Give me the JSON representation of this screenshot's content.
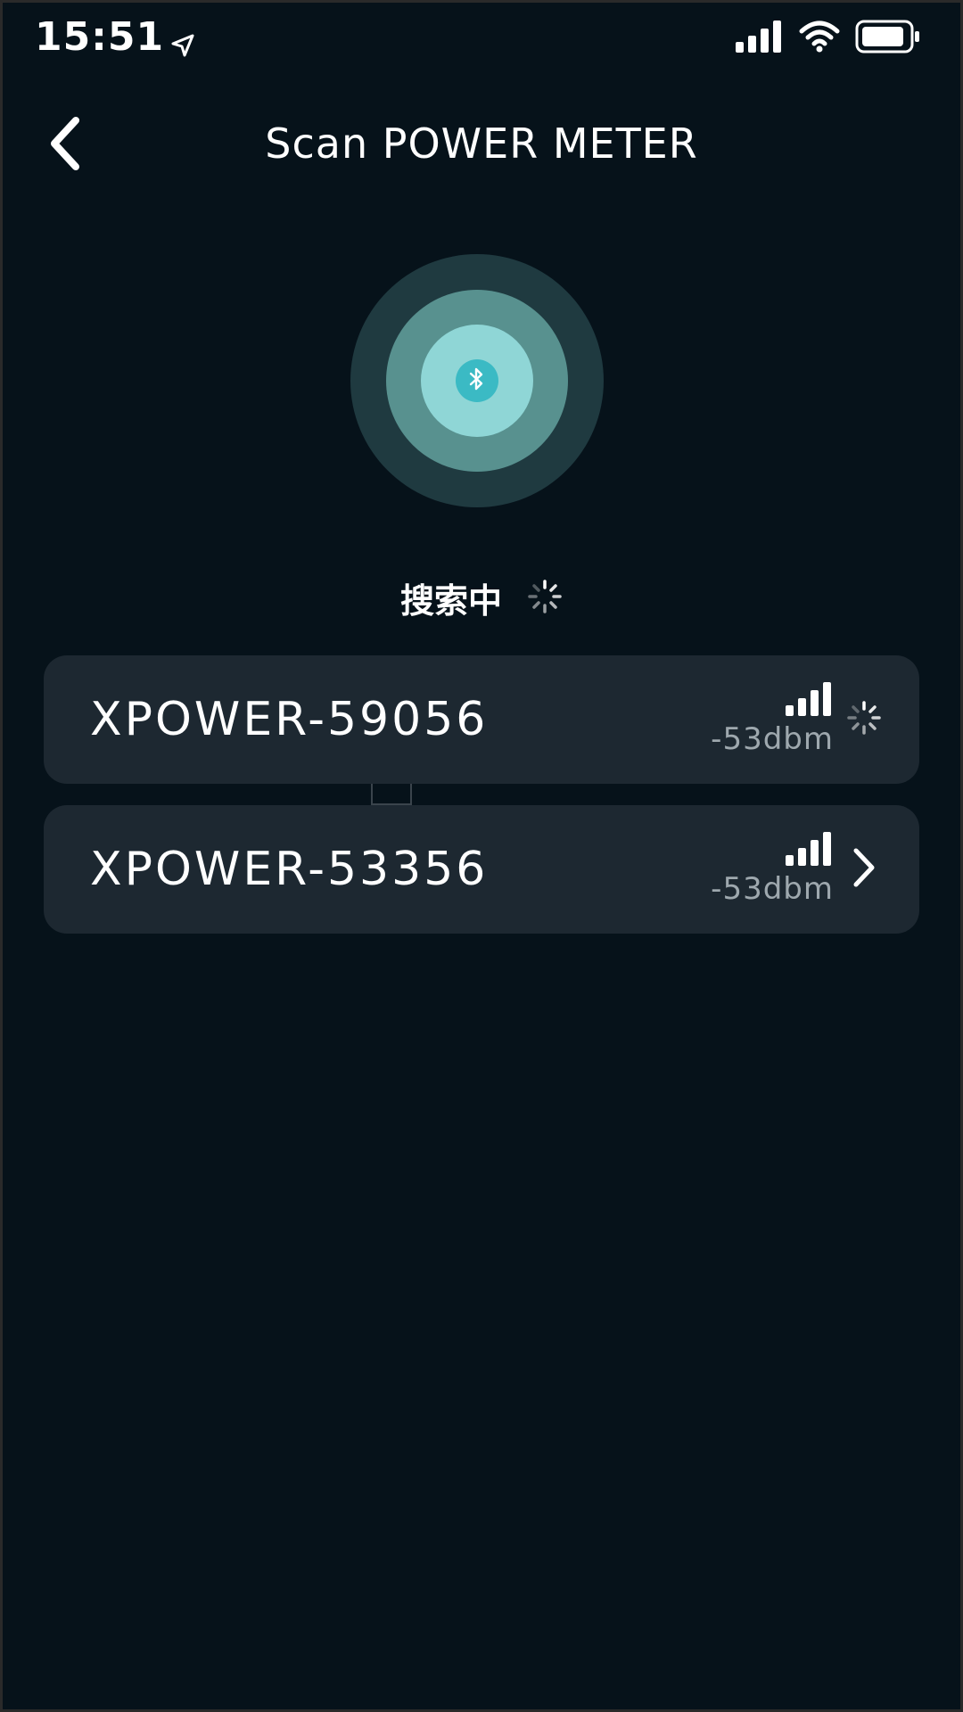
{
  "status_bar": {
    "time": "15:51",
    "icons": [
      "location-arrow-icon",
      "cellular-signal-icon",
      "wifi-icon",
      "battery-icon"
    ]
  },
  "header": {
    "title": "Scan POWER METER",
    "back_icon": "chevron-left-icon"
  },
  "scanner": {
    "icon": "bluetooth-icon",
    "status_label": "搜索中",
    "colors": {
      "outer": "#1f3a40",
      "mid": "#58918f",
      "inner": "#8fd6d6",
      "core": "#3bbac4"
    }
  },
  "devices": [
    {
      "name": "XPOWER-59056",
      "rssi": "-53dbm",
      "signal_icon": "signal-bars-icon",
      "action_icon": "loading-spinner-icon"
    },
    {
      "name": "XPOWER-53356",
      "rssi": "-53dbm",
      "signal_icon": "signal-bars-icon",
      "action_icon": "chevron-right-icon"
    }
  ],
  "theme": {
    "background": "#06121a",
    "card": "#1d2831",
    "text": "#ffffff",
    "muted_text": "#9ea8ae"
  }
}
